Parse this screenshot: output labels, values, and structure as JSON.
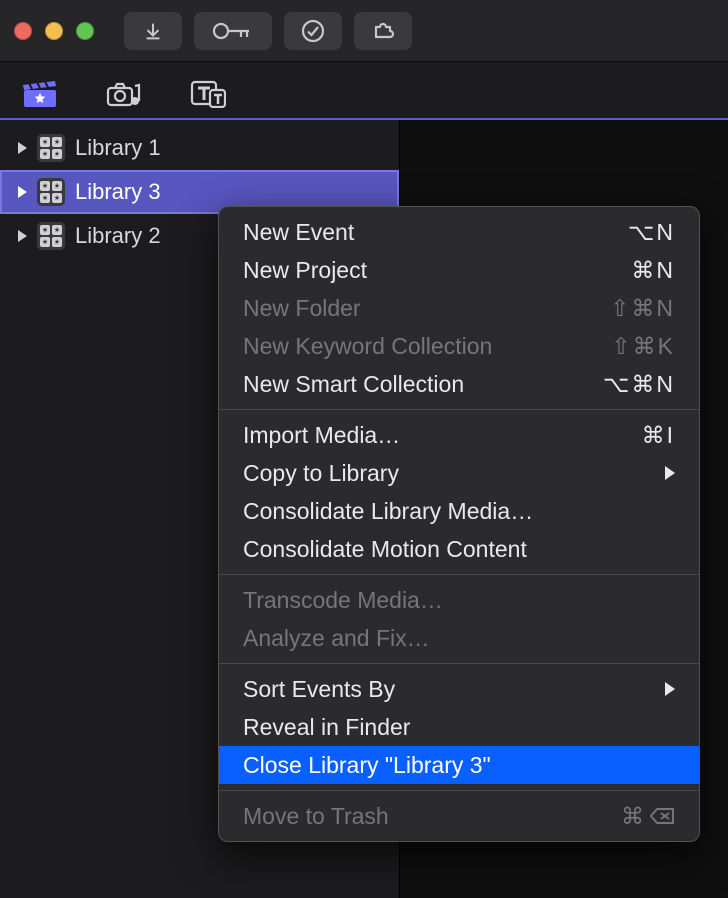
{
  "sidebar": {
    "libraries": [
      {
        "name": "Library 1",
        "selected": false
      },
      {
        "name": "Library 3",
        "selected": true
      },
      {
        "name": "Library 2",
        "selected": false
      }
    ]
  },
  "context_menu": {
    "groups": [
      [
        {
          "label": "New Event",
          "shortcut": "⌥N",
          "disabled": false
        },
        {
          "label": "New Project",
          "shortcut": "⌘N",
          "disabled": false
        },
        {
          "label": "New Folder",
          "shortcut": "⇧⌘N",
          "disabled": true
        },
        {
          "label": "New Keyword Collection",
          "shortcut": "⇧⌘K",
          "disabled": true
        },
        {
          "label": "New Smart Collection",
          "shortcut": "⌥⌘N",
          "disabled": false
        }
      ],
      [
        {
          "label": "Import Media…",
          "shortcut": "⌘I",
          "disabled": false
        },
        {
          "label": "Copy to Library",
          "submenu": true,
          "disabled": false
        },
        {
          "label": "Consolidate Library Media…",
          "disabled": false
        },
        {
          "label": "Consolidate Motion Content",
          "disabled": false
        }
      ],
      [
        {
          "label": "Transcode Media…",
          "disabled": true
        },
        {
          "label": "Analyze and Fix…",
          "disabled": true
        }
      ],
      [
        {
          "label": "Sort Events By",
          "submenu": true,
          "disabled": false
        },
        {
          "label": "Reveal in Finder",
          "disabled": false
        },
        {
          "label": "Close Library \"Library 3\"",
          "disabled": false,
          "highlight": true
        }
      ],
      [
        {
          "label": "Move to Trash",
          "shortcut_icon": "cmd-delete",
          "disabled": true
        }
      ]
    ]
  }
}
